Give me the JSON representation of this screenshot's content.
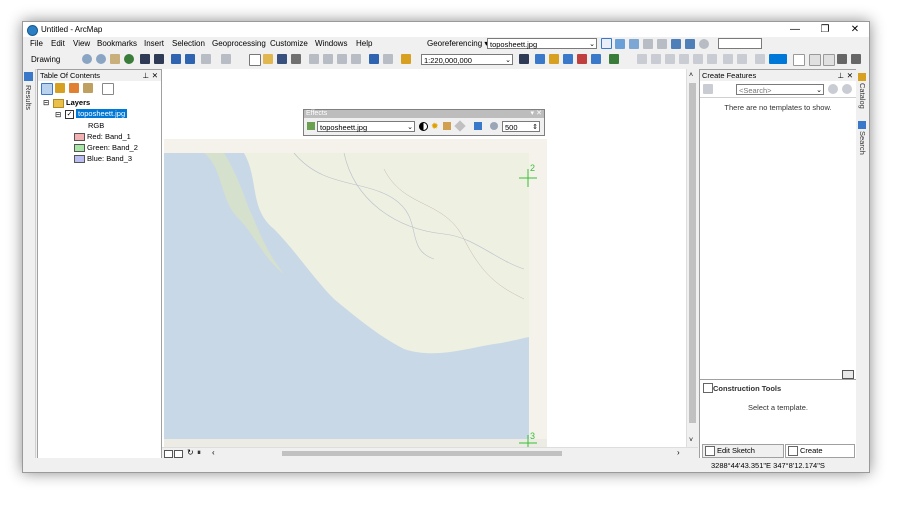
{
  "window": {
    "title": "Untitled - ArcMap"
  },
  "window_controls": {
    "minimize": "—",
    "maximize": "❐",
    "close": "✕"
  },
  "menu": [
    "File",
    "Edit",
    "View",
    "Bookmarks",
    "Insert",
    "Selection",
    "Geoprocessing",
    "Customize",
    "Windows",
    "Help"
  ],
  "georef": {
    "label": "Georeferencing ▾",
    "layer": "toposheett.jpg"
  },
  "toolbar": {
    "drawing_label": "Drawing",
    "scale": "1:220,000,000"
  },
  "toc": {
    "title": "Table Of Contents",
    "layers_label": "Layers",
    "layer_name": "toposheett.jpg",
    "rgb_label": "RGB",
    "bands": [
      {
        "label": "Red:",
        "band": "Band_1",
        "color": "#f3b1b1"
      },
      {
        "label": "Green:",
        "band": "Band_2",
        "color": "#a8e6a8"
      },
      {
        "label": "Blue:",
        "band": "Band_3",
        "color": "#b9bdf0"
      }
    ]
  },
  "left_strip": {
    "results": "Results"
  },
  "effects": {
    "title": "Effects",
    "layer": "toposheett.jpg",
    "value": "500"
  },
  "map": {
    "control_point_1": "2",
    "control_point_2": "3"
  },
  "create_features": {
    "title": "Create Features",
    "search_placeholder": "<Search>",
    "empty_message": "There are no templates to show.",
    "construction_title": "Construction Tools",
    "construction_message": "Select a template.",
    "tab_edit": "Edit Sketch Proper...",
    "tab_create": "Create Features"
  },
  "right_strip": {
    "catalog": "Catalog",
    "search": "Search"
  },
  "status": {
    "coordinates": "3288°44'43.351\"E  347°8'12.174\"S"
  },
  "colors": {
    "accent": "#0078d7",
    "water": "#c9d8e6",
    "land": "#eef0e0",
    "land_green": "#d8e3c7",
    "control_point": "#38c038"
  }
}
